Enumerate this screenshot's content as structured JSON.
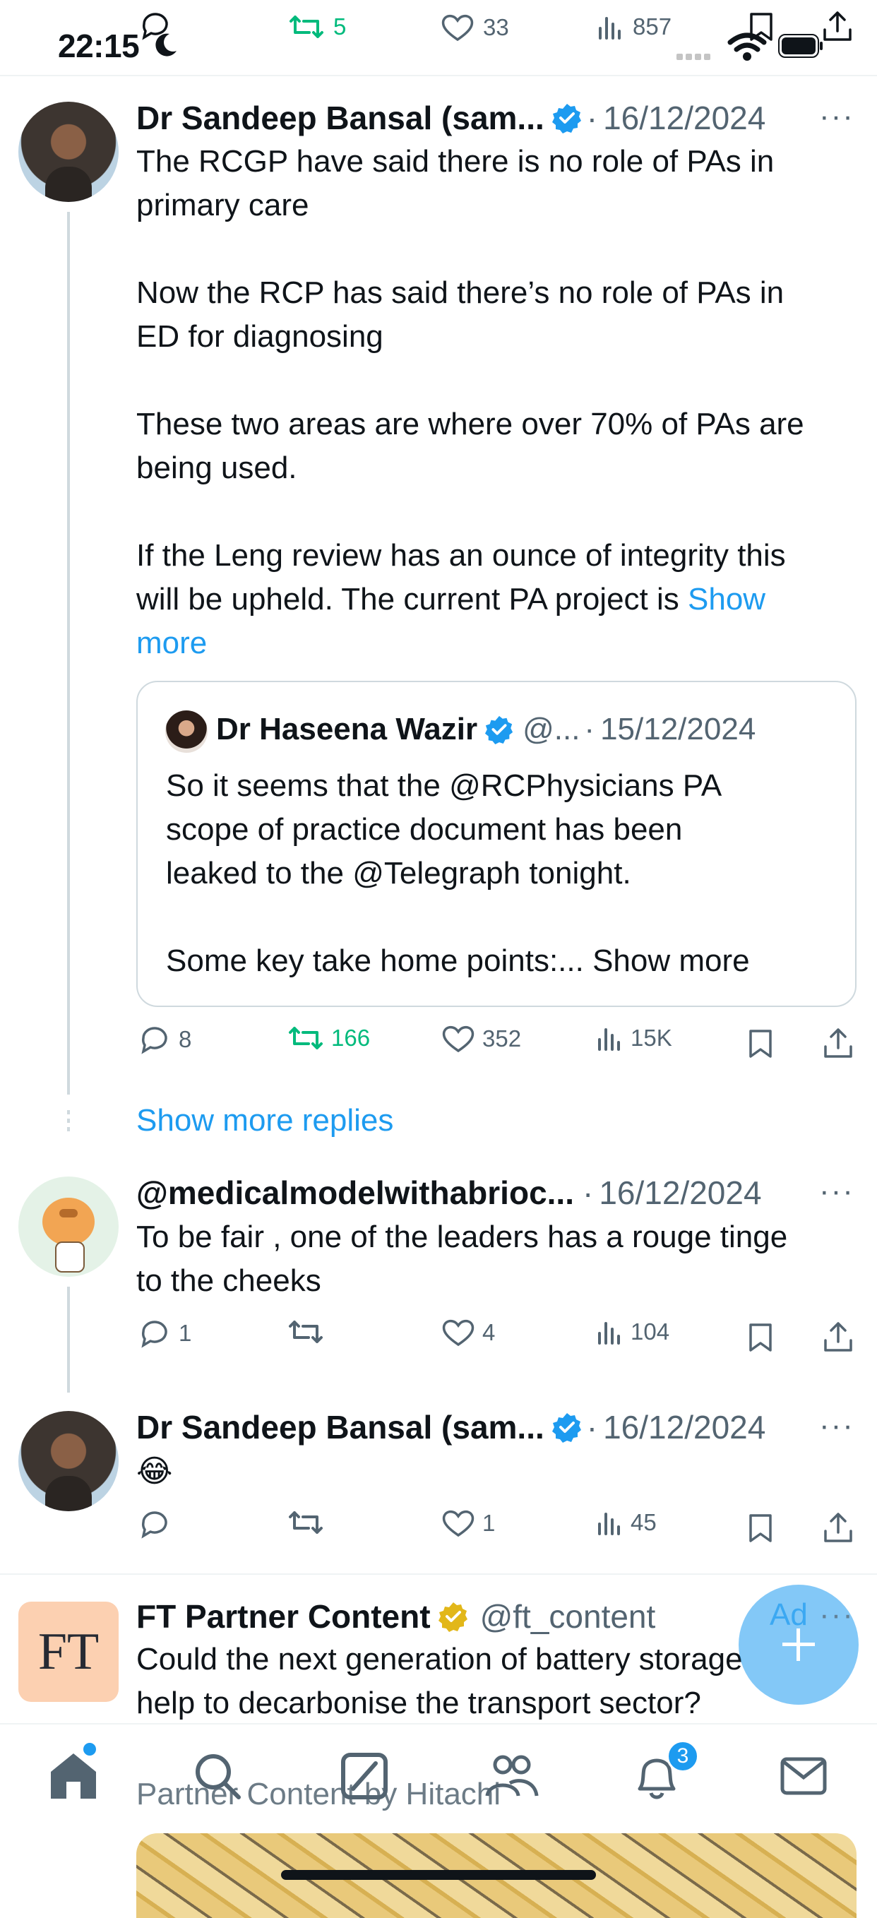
{
  "status_bar": {
    "time": "22:15"
  },
  "top_actions": {
    "retweets": "5",
    "likes": "33",
    "views": "857"
  },
  "tweet1": {
    "author": "Dr Sandeep Bansal (sam...",
    "sep": "·",
    "date": "16/12/2024",
    "body": "The RCGP have said there is no role of PAs in\nprimary care\n\nNow the RCP has said there’s no role of PAs in\nED for diagnosing\n\nThese two areas are where over 70% of PAs are\nbeing used.\n\nIf the Leng review has an ounce of integrity this\nwill be upheld. The current PA project is ",
    "show_more": "Show\nmore",
    "quote": {
      "author": "Dr Haseena Wazir",
      "handle": "@...",
      "sep": "·",
      "date": "15/12/2024",
      "body": "So it seems that the @RCPhysicians PA\nscope of practice document has been\nleaked to the @Telegraph tonight.\n\nSome key take home points:... Show more"
    },
    "replies": "8",
    "retweets": "166",
    "likes": "352",
    "views": "15K"
  },
  "show_more_replies": "Show more replies",
  "tweet2": {
    "author": "@medicalmodelwithabrioc...",
    "sep": "·",
    "date": "16/12/2024",
    "body": "To be fair , one of the leaders has a rouge tinge\nto the cheeks",
    "replies": "1",
    "likes": "4",
    "views": "104"
  },
  "tweet3": {
    "author": "Dr Sandeep Bansal (sam...",
    "sep": "·",
    "date": "16/12/2024",
    "body": "😂",
    "likes": "1",
    "views": "45"
  },
  "ad": {
    "logo_text": "FT",
    "author": "FT Partner Content",
    "handle": "@ft_content",
    "ad_label": "Ad",
    "body": "Could the next generation of battery storage\nhelp to decarbonise the transport sector?",
    "partner_label": "Partner Content by Hitachi"
  },
  "nav": {
    "notifications_count": "3"
  },
  "colors": {
    "accent": "#1d9bf0",
    "retweet_green": "#00ba7c",
    "muted": "#536471",
    "verified_gold": "#e2b719"
  }
}
